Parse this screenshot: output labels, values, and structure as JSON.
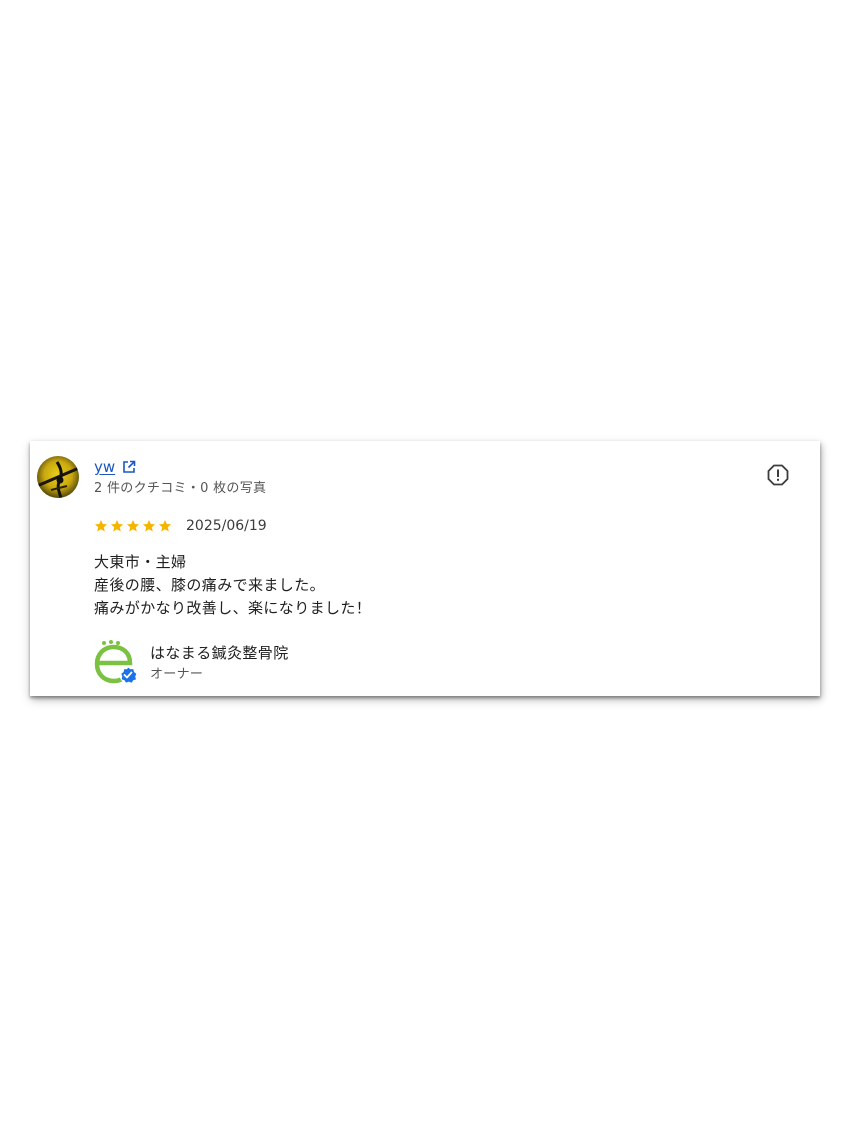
{
  "review": {
    "reviewer": {
      "name": "yw",
      "meta": "2 件のクチコミ・0 枚の写真",
      "avatar_icon": "user-avatar-photo",
      "link_icon": "open-external-icon"
    },
    "rating": {
      "stars": 5,
      "max_stars": 5,
      "star_color": "#f5b400",
      "date": "2025/06/19"
    },
    "body_lines": [
      "大東市・主婦",
      "産後の腰、膝の痛みで来ました。",
      "痛みがかなり改善し、楽になりました！"
    ],
    "report_icon": "report-flag-icon",
    "owner": {
      "name": "はなまる鍼灸整骨院",
      "role": "オーナー",
      "logo_icon": "clinic-logo",
      "verified_icon": "verified-badge-icon",
      "verified_color": "#1a73e8"
    }
  },
  "colors": {
    "link": "#1a56c4",
    "text": "#202020",
    "secondary_text": "#555555",
    "logo_green": "#7cc242"
  }
}
